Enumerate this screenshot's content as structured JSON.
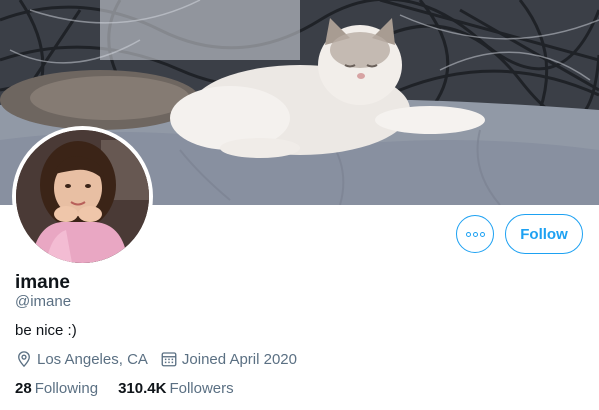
{
  "profile": {
    "display_name": "imane",
    "handle": "@imane",
    "bio": "be nice :)",
    "location": "Los Angeles, CA",
    "joined": "Joined April 2020",
    "following_count": "28",
    "following_label": "Following",
    "followers_count": "310.4K",
    "followers_label": "Followers"
  },
  "actions": {
    "follow_label": "Follow",
    "more_icon": "more-options-icon"
  },
  "icons": {
    "location": "location-pin-icon",
    "calendar": "calendar-icon"
  },
  "colors": {
    "accent": "#1da1f2",
    "secondary_text": "#5b7083",
    "primary_text": "#0f1419"
  }
}
